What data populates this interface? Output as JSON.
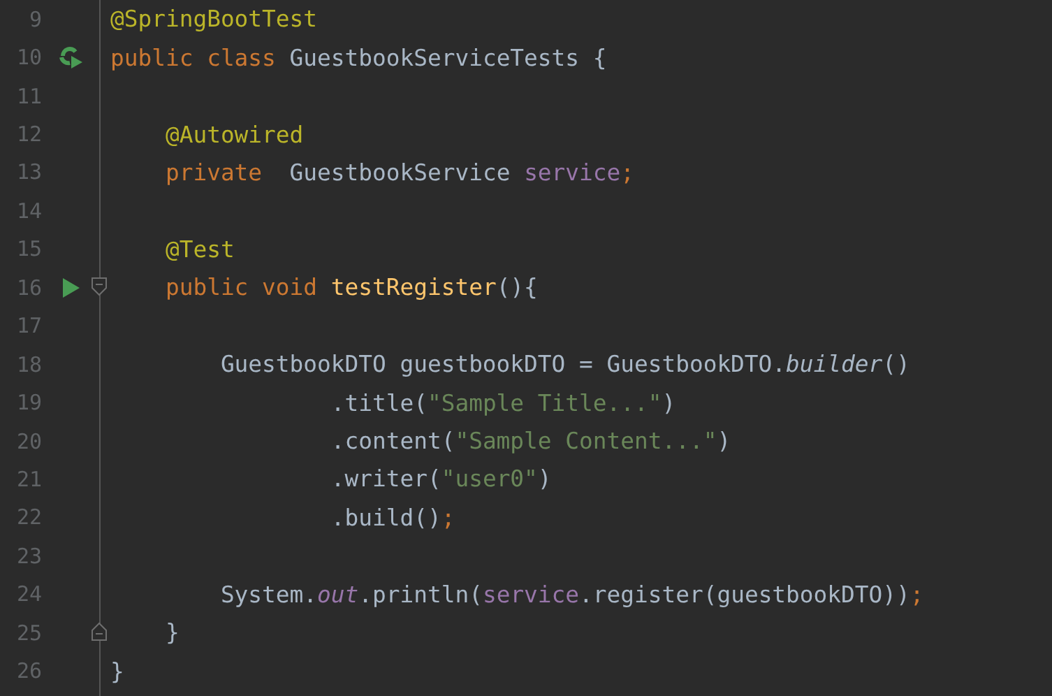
{
  "editor": {
    "lines": [
      {
        "number": "9",
        "tokens": [
          {
            "kind": "annotation",
            "text": "@SpringBootTest"
          }
        ]
      },
      {
        "number": "10",
        "gutter": [
          {
            "kind": "run-class"
          }
        ],
        "tokens": [
          {
            "kind": "keyword",
            "text": "public class "
          },
          {
            "kind": "plain",
            "text": "GuestbookServiceTests {"
          }
        ]
      },
      {
        "number": "11"
      },
      {
        "number": "12",
        "tokens": [
          {
            "kind": "annotation",
            "text": "    @Autowired"
          }
        ]
      },
      {
        "number": "13",
        "tokens": [
          {
            "kind": "keyword",
            "text": "    private  "
          },
          {
            "kind": "plain",
            "text": "GuestbookService "
          },
          {
            "kind": "field",
            "text": "service"
          },
          {
            "kind": "keyword",
            "text": ";"
          }
        ]
      },
      {
        "number": "14"
      },
      {
        "number": "15",
        "tokens": [
          {
            "kind": "annotation",
            "text": "    @Test"
          }
        ]
      },
      {
        "number": "16",
        "gutter": [
          {
            "kind": "run"
          },
          {
            "kind": "fold-start"
          }
        ],
        "tokens": [
          {
            "kind": "keyword",
            "text": "    public void "
          },
          {
            "kind": "method",
            "text": "testRegister"
          },
          {
            "kind": "plain",
            "text": "(){"
          }
        ]
      },
      {
        "number": "17"
      },
      {
        "number": "18",
        "tokens": [
          {
            "kind": "plain",
            "text": "        GuestbookDTO guestbookDTO = GuestbookDTO."
          },
          {
            "kind": "static-method",
            "text": "builder"
          },
          {
            "kind": "plain",
            "text": "()"
          }
        ]
      },
      {
        "number": "19",
        "tokens": [
          {
            "kind": "plain",
            "text": "                .title("
          },
          {
            "kind": "string",
            "text": "\"Sample Title...\""
          },
          {
            "kind": "plain",
            "text": ")"
          }
        ]
      },
      {
        "number": "20",
        "tokens": [
          {
            "kind": "plain",
            "text": "                .content("
          },
          {
            "kind": "string",
            "text": "\"Sample Content...\""
          },
          {
            "kind": "plain",
            "text": ")"
          }
        ]
      },
      {
        "number": "21",
        "tokens": [
          {
            "kind": "plain",
            "text": "                .writer("
          },
          {
            "kind": "string",
            "text": "\"user0\""
          },
          {
            "kind": "plain",
            "text": ")"
          }
        ]
      },
      {
        "number": "22",
        "tokens": [
          {
            "kind": "plain",
            "text": "                .build()"
          },
          {
            "kind": "keyword",
            "text": ";"
          }
        ]
      },
      {
        "number": "23"
      },
      {
        "number": "24",
        "tokens": [
          {
            "kind": "plain",
            "text": "        System."
          },
          {
            "kind": "static-field",
            "text": "out"
          },
          {
            "kind": "plain",
            "text": ".println("
          },
          {
            "kind": "field",
            "text": "service"
          },
          {
            "kind": "plain",
            "text": ".register(guestbookDTO))"
          },
          {
            "kind": "keyword",
            "text": ";"
          }
        ]
      },
      {
        "number": "25",
        "gutter": [
          {
            "kind": "fold-end"
          }
        ],
        "tokens": [
          {
            "kind": "plain",
            "text": "    }"
          }
        ]
      },
      {
        "number": "26",
        "tokens": [
          {
            "kind": "plain",
            "text": "}"
          }
        ]
      }
    ]
  }
}
